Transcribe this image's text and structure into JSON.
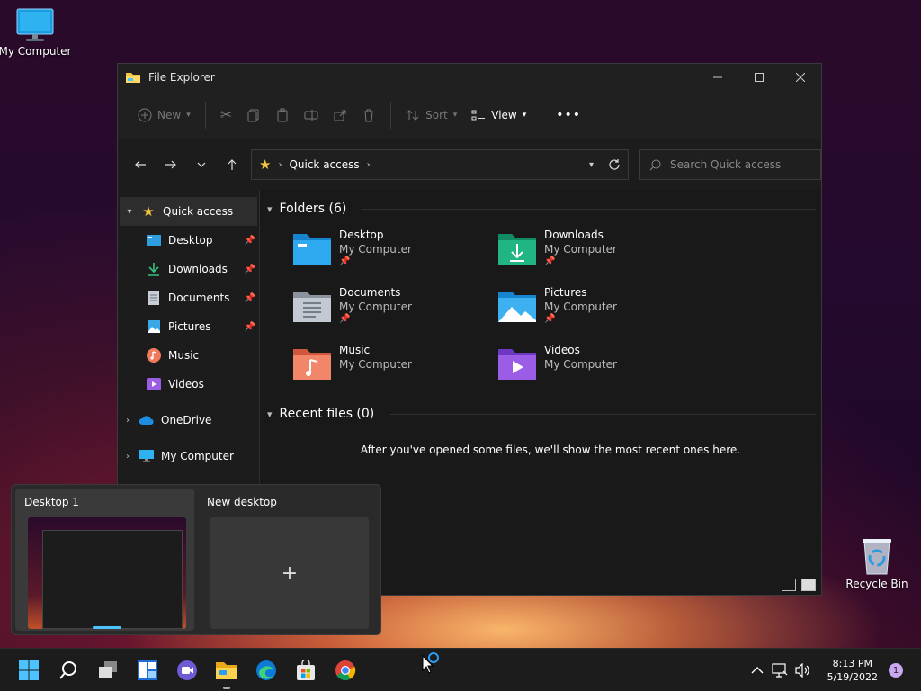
{
  "desktop": {
    "my_computer_label": "My Computer",
    "recycle_bin_label": "Recycle Bin"
  },
  "window": {
    "title": "File Explorer",
    "toolbar": {
      "new_label": "New",
      "sort_label": "Sort",
      "view_label": "View",
      "more_label": "•••"
    },
    "address": {
      "location": "Quick access",
      "search_placeholder": "Search Quick access"
    },
    "nav": {
      "quick_access": "Quick access",
      "items": [
        {
          "label": "Desktop"
        },
        {
          "label": "Downloads"
        },
        {
          "label": "Documents"
        },
        {
          "label": "Pictures"
        },
        {
          "label": "Music"
        },
        {
          "label": "Videos"
        }
      ],
      "onedrive": "OneDrive",
      "my_computer": "My Computer"
    },
    "folders_header": "Folders (6)",
    "folders": [
      {
        "name": "Desktop",
        "location": "My Computer",
        "icon": "desktop-folder-icon",
        "pinned": true
      },
      {
        "name": "Downloads",
        "location": "My Computer",
        "icon": "downloads-folder-icon",
        "pinned": true
      },
      {
        "name": "Documents",
        "location": "My Computer",
        "icon": "documents-folder-icon",
        "pinned": true
      },
      {
        "name": "Pictures",
        "location": "My Computer",
        "icon": "pictures-folder-icon",
        "pinned": true
      },
      {
        "name": "Music",
        "location": "My Computer",
        "icon": "music-folder-icon",
        "pinned": false
      },
      {
        "name": "Videos",
        "location": "My Computer",
        "icon": "videos-folder-icon",
        "pinned": false
      }
    ],
    "recent_header": "Recent files (0)",
    "recent_empty_message": "After you've opened some files, we'll show the most recent ones here."
  },
  "taskview": {
    "desktops": [
      {
        "name": "Desktop 1",
        "active": true
      },
      {
        "name": "New desktop",
        "active": false
      }
    ],
    "new_symbol": "+"
  },
  "taskbar": {
    "time": "8:13 PM",
    "date": "5/19/2022",
    "notification_count": "1"
  },
  "colors": {
    "accent": "#4cc2ff",
    "folder_yellow": "#f4c542",
    "window_bg": "#191919",
    "taskbar_bg": "#1c1c1c"
  }
}
